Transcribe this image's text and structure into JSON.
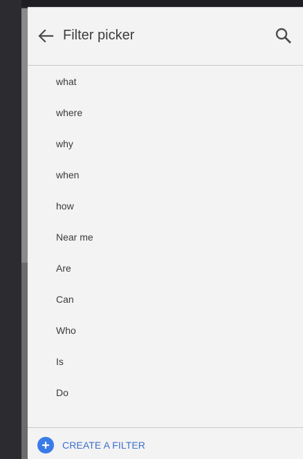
{
  "header": {
    "title": "Filter picker",
    "back_icon": "arrow-left-icon",
    "search_icon": "search-icon"
  },
  "filters": [
    {
      "label": "what"
    },
    {
      "label": "where"
    },
    {
      "label": "why"
    },
    {
      "label": "when"
    },
    {
      "label": "how"
    },
    {
      "label": "Near me"
    },
    {
      "label": "Are"
    },
    {
      "label": "Can"
    },
    {
      "label": "Who"
    },
    {
      "label": "Is"
    },
    {
      "label": "Do"
    }
  ],
  "footer": {
    "create_label": "CREATE A FILTER",
    "create_icon": "plus-circle-icon"
  },
  "colors": {
    "panel_bg": "#f3f3f3",
    "accent": "#3a7be8",
    "link": "#3c6fc9",
    "backdrop": "#2b2b30"
  }
}
